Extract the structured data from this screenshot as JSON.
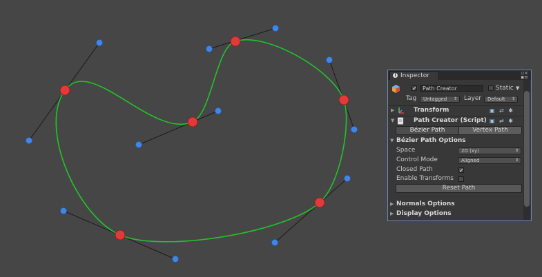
{
  "scene": {
    "background": "#464646",
    "path_color": "#22c22a",
    "anchor_color": "#e23a3a",
    "handle_color": "#3e86e8",
    "handle_line_color": "#1a1a1a"
  },
  "inspector": {
    "tab_label": "Inspector",
    "object_name": "Path Creator",
    "static_label": "Static",
    "tag_label": "Tag",
    "tag_value": "Untagged",
    "layer_label": "Layer",
    "layer_value": "Default",
    "transform_label": "Transform",
    "script_label": "Path Creator (Script)",
    "bezier_tab": "Bézier Path",
    "vertex_tab": "Vertex Path",
    "options_header": "Bézier Path Options",
    "space_label": "Space",
    "space_value": "2D (xy)",
    "control_mode_label": "Control Mode",
    "control_mode_value": "Aligned",
    "closed_path_label": "Closed Path",
    "enable_transforms_label": "Enable Transforms",
    "reset_button": "Reset Path",
    "normals_header": "Normals Options",
    "display_header": "Display Options"
  }
}
